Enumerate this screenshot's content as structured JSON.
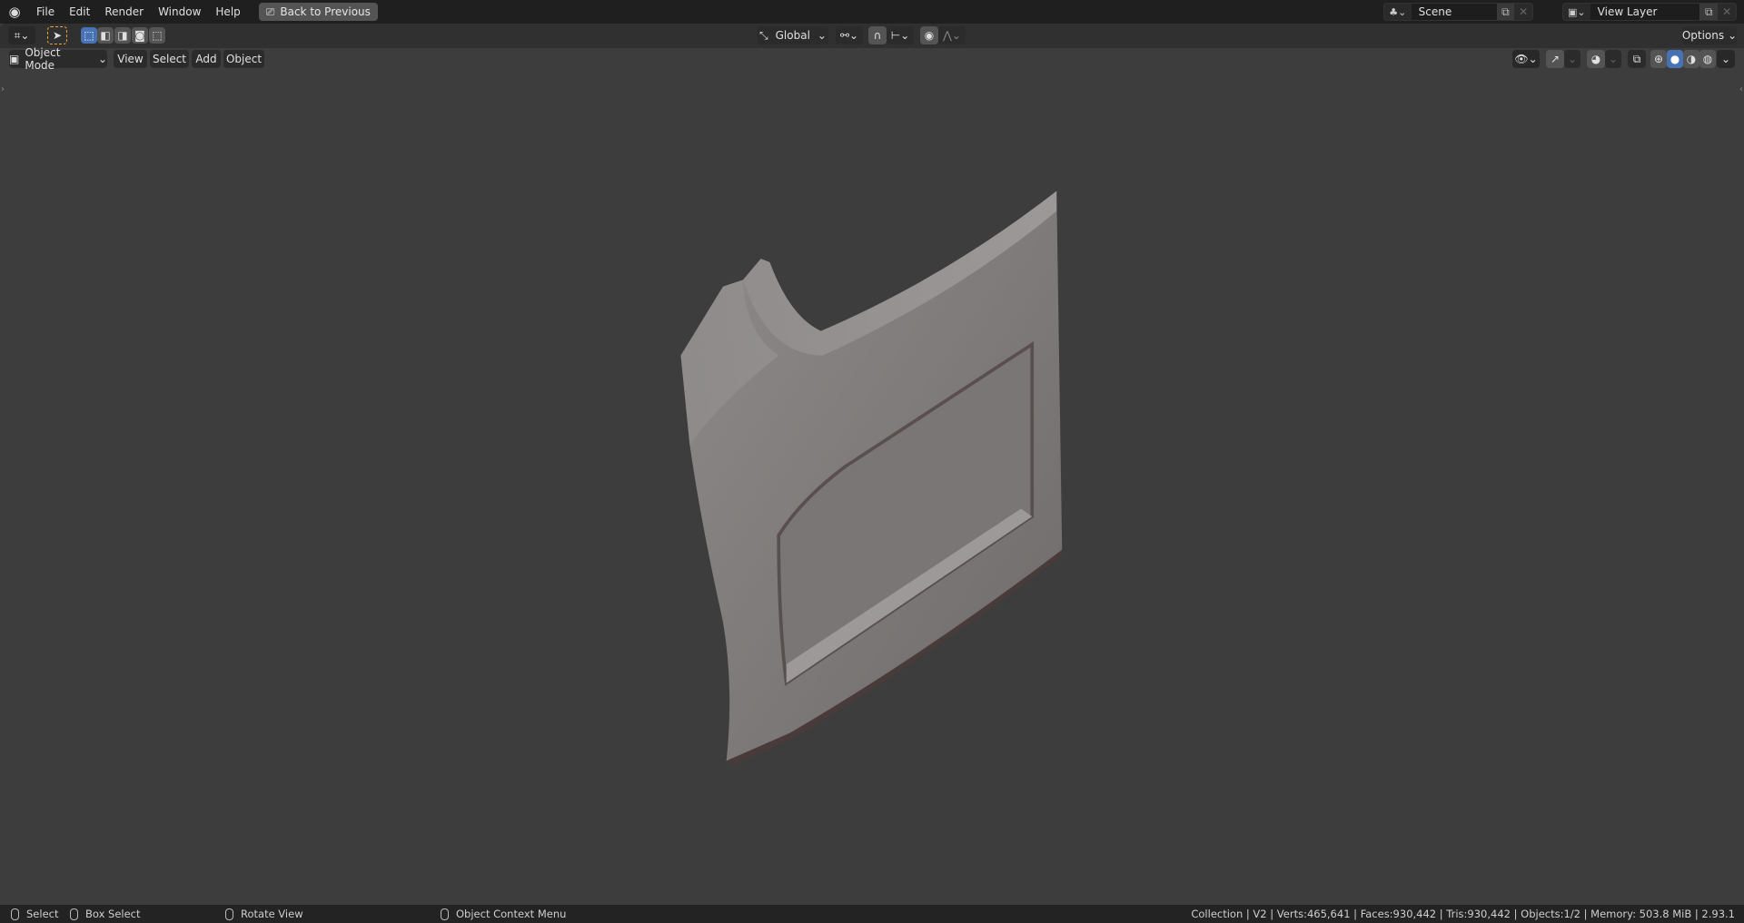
{
  "topbar": {
    "menus": [
      "File",
      "Edit",
      "Render",
      "Window",
      "Help"
    ],
    "back_button": "Back to Previous",
    "scene": "Scene",
    "view_layer": "View Layer"
  },
  "toolbar": {
    "orientation": "Global",
    "options": "Options"
  },
  "viewport_header": {
    "mode": "Object Mode",
    "menus": [
      "View",
      "Select",
      "Add",
      "Object"
    ]
  },
  "statusbar": {
    "select": "Select",
    "box_select": "Box Select",
    "rotate_view": "Rotate View",
    "context_menu": "Object Context Menu",
    "stats": "Collection | V2 | Verts:465,641 | Faces:930,442 | Tris:930,442 | Objects:1/2 | Memory: 503.8 MiB | 2.93.1"
  },
  "colors": {
    "accent": "#4772b3",
    "active_tool": "#f0a030",
    "background": "#3d3d3d"
  }
}
